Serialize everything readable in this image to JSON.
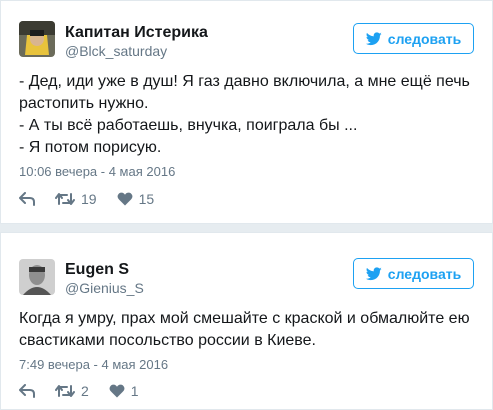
{
  "colors": {
    "accent": "#1da1f2",
    "muted": "#657786",
    "background": "#e6ecf0"
  },
  "tweets": [
    {
      "name": "Капитан Истерика",
      "handle": "@Blck_saturday",
      "follow_label": "следовать",
      "text_lines": [
        "- Дед, иди уже в душ! Я газ давно включила, а мне ещё печь",
        "растопить нужно.",
        "- А ты всё работаешь, внучка, поиграла бы ...",
        "- Я потом порисую."
      ],
      "time": "10:06 вечера - 4 мая 2016",
      "retweets": "19",
      "likes": "15",
      "icons": {
        "reply": "reply-icon",
        "retweet": "retweet-icon",
        "like": "heart-icon",
        "follow": "twitter-bird-icon"
      }
    },
    {
      "name": "Eugen S",
      "handle": "@Gienius_S",
      "follow_label": "следовать",
      "text_lines": [
        "Когда я умру, прах мой смешайте с краской и обмалюйте ею",
        "свастиками посольство россии в Киеве."
      ],
      "time": "7:49 вечера - 4 мая 2016",
      "retweets": "2",
      "likes": "1",
      "icons": {
        "reply": "reply-icon",
        "retweet": "retweet-icon",
        "like": "heart-icon",
        "follow": "twitter-bird-icon"
      }
    }
  ]
}
